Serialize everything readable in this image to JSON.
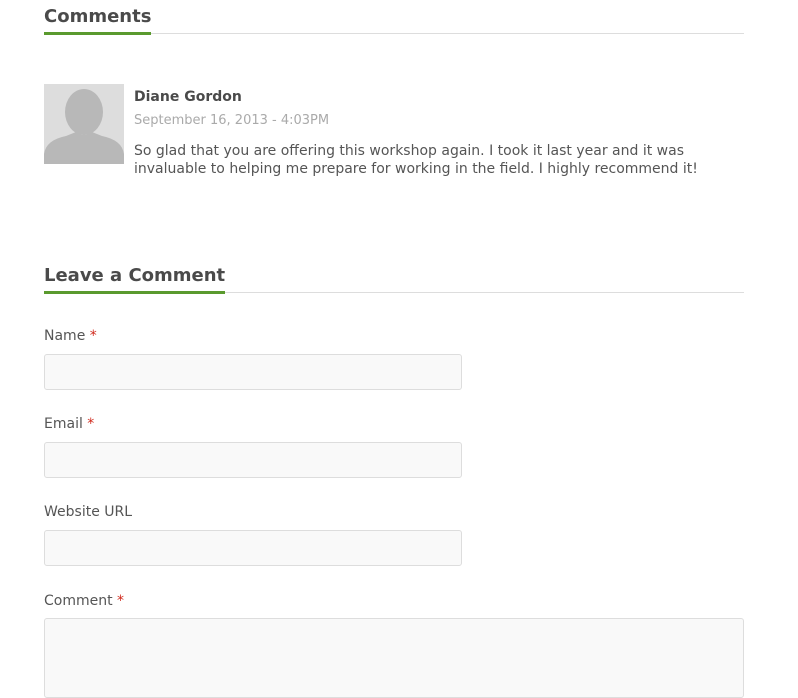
{
  "comments_section": {
    "heading": "Comments",
    "items": [
      {
        "author": "Diane Gordon",
        "date": "September 16, 2013 - 4:03PM",
        "text": "So glad that you are offering this workshop again. I took it last year and it was invaluable to helping me prepare for working in the field. I highly recommend it!",
        "avatar_icon": "default-avatar-icon"
      }
    ]
  },
  "comment_form": {
    "heading": "Leave a Comment",
    "required_marker": "*",
    "fields": {
      "name": {
        "label": "Name",
        "value": "",
        "required": true
      },
      "email": {
        "label": "Email",
        "value": "",
        "required": true
      },
      "website": {
        "label": "Website URL",
        "value": "",
        "required": false
      },
      "comment": {
        "label": "Comment",
        "value": "",
        "required": true
      }
    }
  },
  "colors": {
    "accent": "#5a9a2e",
    "required": "#d0281b",
    "heading_text": "#4a4a4a",
    "body_text": "#555555",
    "muted_text": "#aaaaaa"
  }
}
